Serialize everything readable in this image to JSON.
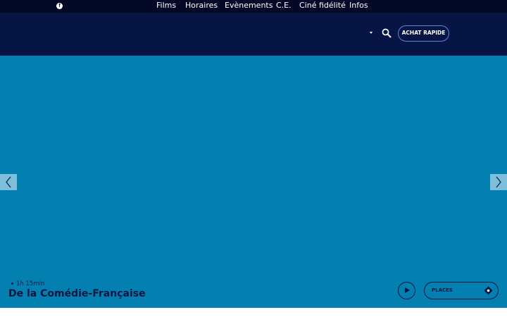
{
  "topbar": {
    "social_icons": [
      "facebook-icon"
    ]
  },
  "nav": {
    "items": [
      {
        "label": "Films"
      },
      {
        "label": "Horaires"
      },
      {
        "label": "Evènements"
      },
      {
        "label": "C.E."
      },
      {
        "label": "Ciné fidélité"
      },
      {
        "label": "Infos"
      }
    ],
    "infos_has_dropdown": true,
    "search_icon": "search-icon",
    "cta_label": "ACHAT RAPIDE"
  },
  "hero": {
    "background_color": "#0480b0",
    "prev_icon": "chevron-left-icon",
    "next_icon": "chevron-right-icon",
    "film": {
      "duration": "1h 15min",
      "title": "De la Comédie-Française"
    },
    "play_icon": "play-icon",
    "places_label": "PLACES",
    "places_icon": "ticket-icon"
  },
  "colors": {
    "header": "#061544",
    "topbar": "#020826",
    "accent_border": "#5f86d8",
    "arrow_bg": "#7dbedb"
  }
}
